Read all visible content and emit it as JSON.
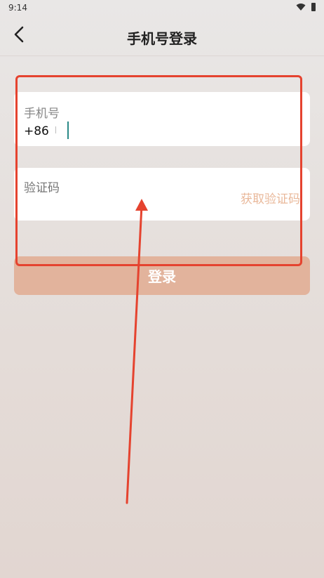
{
  "status_bar": {
    "time": "9:14",
    "wifi_icon": "wifi-icon",
    "battery_icon": "battery-icon"
  },
  "header": {
    "title": "手机号登录",
    "back_icon": "chevron-left-icon"
  },
  "phone_field": {
    "label": "手机号",
    "country_code": "+86",
    "value": ""
  },
  "code_field": {
    "label": "验证码",
    "value": "",
    "get_code_label": "获取验证码"
  },
  "login_button": {
    "label": "登录"
  },
  "colors": {
    "accent_button": "#e2b39c",
    "get_code_text": "#e9b89a",
    "caret": "#2a8a87",
    "annotation_red": "#e5432f"
  }
}
